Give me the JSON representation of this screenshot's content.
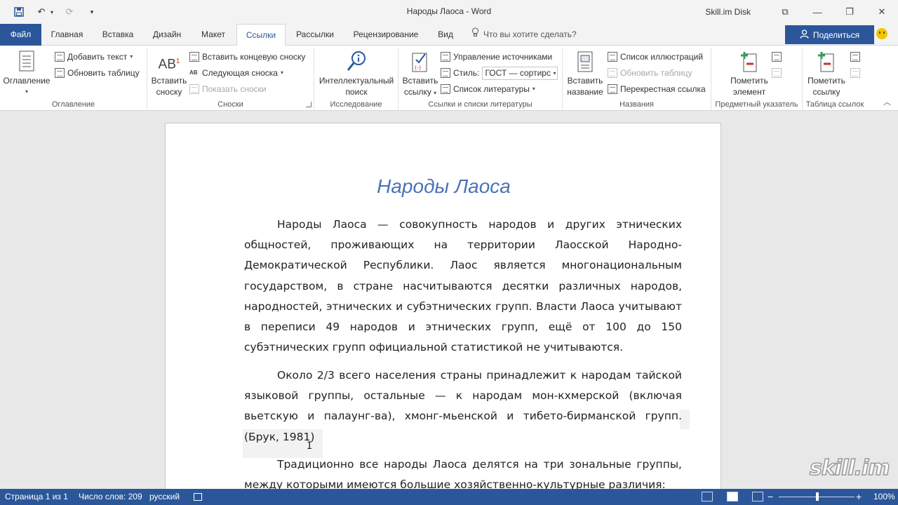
{
  "window": {
    "title": "Народы Лаоса  -  Word",
    "user": "Skill.im Disk",
    "controls": {
      "ribbon_display": "⧉",
      "minimize": "—",
      "restore": "❐",
      "close": "✕"
    }
  },
  "qat": {
    "save": "💾",
    "undo": "↶",
    "undo_dd": "▾",
    "redo": "⟳",
    "customize": "▾"
  },
  "tabs": [
    {
      "label": "Файл"
    },
    {
      "label": "Главная"
    },
    {
      "label": "Вставка"
    },
    {
      "label": "Дизайн"
    },
    {
      "label": "Макет"
    },
    {
      "label": "Ссылки"
    },
    {
      "label": "Рассылки"
    },
    {
      "label": "Рецензирование"
    },
    {
      "label": "Вид"
    }
  ],
  "tellme": {
    "icon": "lightbulb-icon",
    "glyph": "💡",
    "placeholder": "Что вы хотите сделать?"
  },
  "share": {
    "label": "Поделиться",
    "icon": "person-icon"
  },
  "ribbon": {
    "toc": {
      "group_label": "Оглавление",
      "big_button": "Оглавление",
      "add_text": "Добавить текст",
      "update_table": "Обновить таблицу"
    },
    "footnotes": {
      "group_label": "Сноски",
      "insert_footnote_line1": "Вставить",
      "insert_footnote_line2": "сноску",
      "ab_glyph": "AB",
      "sup": "1",
      "insert_endnote": "Вставить концевую сноску",
      "next_footnote": "Следующая сноска",
      "show_notes": "Показать сноски"
    },
    "research": {
      "group_label": "Исследование",
      "smart_lookup_line1": "Интеллектуальный",
      "smart_lookup_line2": "поиск"
    },
    "citations": {
      "group_label": "Ссылки и списки литературы",
      "insert_citation_line1": "Вставить",
      "insert_citation_line2": "ссылку",
      "manage_sources": "Управление источниками",
      "style_label": "Стиль:",
      "style_value": "ГОСТ — сортирс",
      "bibliography": "Список литературы"
    },
    "captions": {
      "group_label": "Названия",
      "insert_caption_line1": "Вставить",
      "insert_caption_line2": "название",
      "table_of_figures": "Список иллюстраций",
      "update_table": "Обновить таблицу",
      "cross_reference": "Перекрестная ссылка"
    },
    "index": {
      "group_label": "Предметный указатель",
      "mark_entry_line1": "Пометить",
      "mark_entry_line2": "элемент"
    },
    "authorities": {
      "group_label": "Таблица ссылок",
      "mark_citation_line1": "Пометить",
      "mark_citation_line2": "ссылку"
    }
  },
  "document": {
    "title": "Народы Лаоса",
    "paragraphs": [
      "Народы Лаоса — совокупность народов и других этнических общностей, проживающих на территории Лаосской Народно-Демократической Республики. Лаос является многонациональным государством, в стране насчитываются десятки различных народов, народностей, этнических и субэтнических групп. Власти Лаоса учитывают в переписи 49 народов и этнических групп, ещё от 100 до 150 субэтнических групп официальной статистикой не учитываются.",
      "Около 2/3 всего населения страны принадлежит к народам тайской языковой группы, остальные — к народам мон-кхмерской (включая вьетскую и палаунг-ва), хмонг-мьенской и тибето-бирманской групп. (Брук, 1981)",
      "Традиционно все народы Лаоса делятся на три зональные группы, между которыми имеются большие хозяйственно-культурные различия:"
    ],
    "cursor_glyph": "I",
    "watermark": "skill.im"
  },
  "status": {
    "page": "Страница 1 из 1",
    "words": "Число слов: 209",
    "language": "русский",
    "zoom": "100%",
    "zoom_minus": "−",
    "zoom_plus": "+",
    "zoom_level": 1.0
  }
}
